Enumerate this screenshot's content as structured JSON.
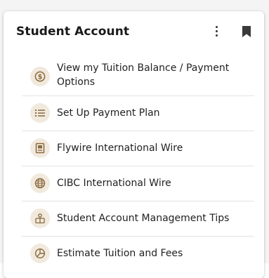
{
  "card": {
    "title": "Student Account",
    "menu_icon": "kebab-menu-icon",
    "bookmark_icon": "bookmark-icon"
  },
  "colors": {
    "icon_bg": "#f1e9dd",
    "icon_fg": "#8a6a3f"
  },
  "items": [
    {
      "label": "View my Tuition Balance / Payment Options",
      "icon": "dollar-circle-icon"
    },
    {
      "label": "Set Up Payment Plan",
      "icon": "list-icon"
    },
    {
      "label": "Flywire International Wire",
      "icon": "id-card-icon"
    },
    {
      "label": "CIBC International Wire",
      "icon": "globe-icon"
    },
    {
      "label": "Student Account Management Tips",
      "icon": "hand-coins-icon"
    },
    {
      "label": "Estimate Tuition and Fees",
      "icon": "pie-chart-icon"
    }
  ]
}
